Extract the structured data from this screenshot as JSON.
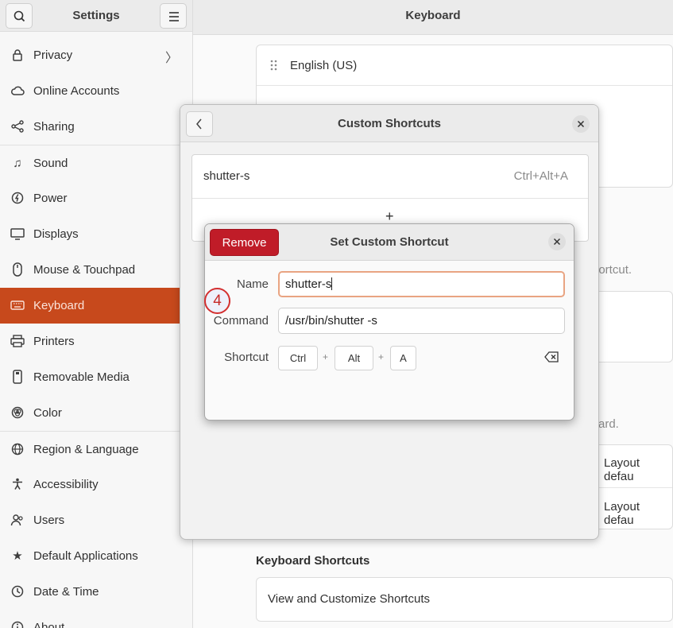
{
  "sidebar": {
    "title": "Settings",
    "items": [
      {
        "label": "Privacy",
        "icon": "lock-icon",
        "glyph": "🔒"
      },
      {
        "label": "Online Accounts",
        "icon": "cloud-icon",
        "glyph": "☁"
      },
      {
        "label": "Sharing",
        "icon": "share-icon",
        "glyph": "⋘"
      },
      {
        "label": "Sound",
        "icon": "music-note-icon",
        "glyph": "♫"
      },
      {
        "label": "Power",
        "icon": "power-icon",
        "glyph": "⏻"
      },
      {
        "label": "Displays",
        "icon": "display-icon",
        "glyph": "▭"
      },
      {
        "label": "Mouse & Touchpad",
        "icon": "mouse-icon",
        "glyph": "◉"
      },
      {
        "label": "Keyboard",
        "icon": "keyboard-icon",
        "glyph": "⌨"
      },
      {
        "label": "Printers",
        "icon": "printer-icon",
        "glyph": "⎙"
      },
      {
        "label": "Removable Media",
        "icon": "removable-media-icon",
        "glyph": "⏏"
      },
      {
        "label": "Color",
        "icon": "color-icon",
        "glyph": "◎"
      },
      {
        "label": "Region & Language",
        "icon": "globe-icon",
        "glyph": "🌐"
      },
      {
        "label": "Accessibility",
        "icon": "accessibility-icon",
        "glyph": "♿"
      },
      {
        "label": "Users",
        "icon": "users-icon",
        "glyph": "☺"
      },
      {
        "label": "Default Applications",
        "icon": "star-icon",
        "glyph": "★"
      },
      {
        "label": "Date & Time",
        "icon": "clock-icon",
        "glyph": "◷"
      },
      {
        "label": "About",
        "icon": "info-icon",
        "glyph": "ⓘ"
      }
    ]
  },
  "main": {
    "title": "Keyboard",
    "input_source": "English (US)",
    "partial_shortcut_text": "hortcut.",
    "partial_board_text": "ard.",
    "layout_default_1": "Layout defau",
    "layout_default_2": "Layout defau",
    "keyboard_shortcuts_heading": "Keyboard Shortcuts",
    "view_customize": "View and Customize Shortcuts"
  },
  "custom_shortcuts_dialog": {
    "title": "Custom Shortcuts",
    "entry_name": "shutter-s",
    "entry_accel": "Ctrl+Alt+A",
    "add_symbol": "+"
  },
  "set_shortcut_dialog": {
    "title": "Set Custom Shortcut",
    "remove_label": "Remove",
    "name_label": "Name",
    "name_value": "shutter-s",
    "command_label": "Command",
    "command_value": "/usr/bin/shutter -s",
    "shortcut_label": "Shortcut",
    "keys": [
      "Ctrl",
      "Alt",
      "A"
    ],
    "plus": "+"
  },
  "annotation": {
    "step": "4"
  }
}
